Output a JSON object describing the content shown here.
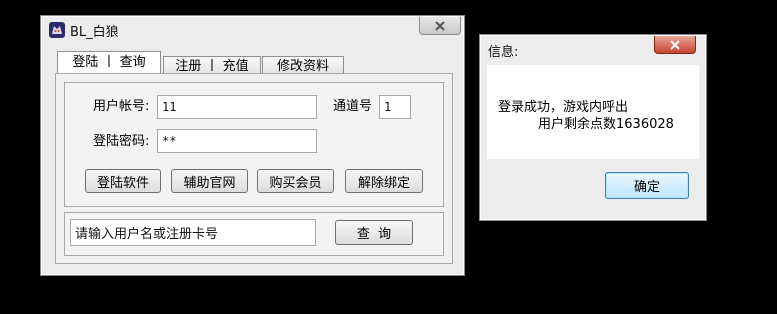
{
  "main_window": {
    "title": "BL_白狼",
    "tabs": [
      {
        "label": "登陆 丨 查询"
      },
      {
        "label": "注册 丨 充值"
      },
      {
        "label": "修改资料"
      }
    ],
    "login": {
      "account_label": "用户帐号:",
      "account_value": "11",
      "channel_label": "通道号",
      "channel_value": "1",
      "password_label": "登陆密码:",
      "password_value": "**",
      "buttons": {
        "login": "登陆软件",
        "website": "辅助官网",
        "buy": "购买会员",
        "unbind": "解除绑定"
      }
    },
    "query": {
      "input_value": "请输入用户名或注册卡号",
      "button": "查  询"
    }
  },
  "message_box": {
    "title": "信息:",
    "line1": "登录成功，游戏内呼出",
    "line2": "用户剩余点数1636028",
    "ok_button": "确定"
  },
  "icons": {
    "app_icon": "wolf-app-icon",
    "close": "close-icon"
  }
}
